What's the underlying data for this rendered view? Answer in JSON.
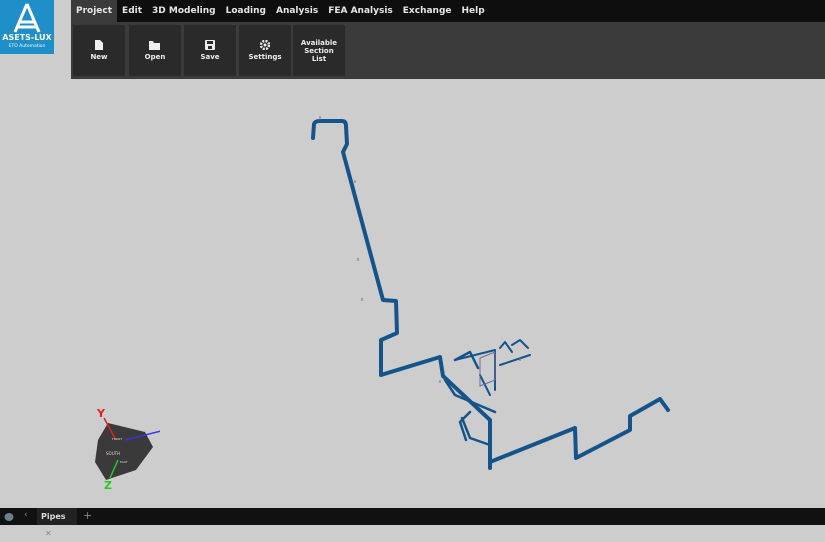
{
  "logo": {
    "brand": "ASETS-LUX",
    "subtitle": "ETO Automation"
  },
  "menu": [
    {
      "label": "Project",
      "active": true
    },
    {
      "label": "Edit"
    },
    {
      "label": "3D Modeling"
    },
    {
      "label": "Loading"
    },
    {
      "label": "Analysis"
    },
    {
      "label": "FEA Analysis"
    },
    {
      "label": "Exchange"
    },
    {
      "label": "Help"
    }
  ],
  "ribbon": [
    {
      "label": "New",
      "icon": "file-icon"
    },
    {
      "label": "Open",
      "icon": "folder-open-icon"
    },
    {
      "label": "Save",
      "icon": "save-icon"
    },
    {
      "label": "Settings",
      "icon": "gear-icon"
    },
    {
      "label": "Available Section List",
      "icon": ""
    }
  ],
  "gizmo": {
    "x": "X",
    "y": "Y",
    "z": "Z",
    "face_top": "FRONT",
    "face_side": "SOUTH",
    "face_label": "EAST"
  },
  "bottom": {
    "tab": "Pipes",
    "close": "✕",
    "add": "+",
    "nav": "‹"
  },
  "colors": {
    "pipe": "#15548a",
    "logo": "#1e8fc8",
    "x_axis": "#3333ee",
    "y_axis": "#dd2222",
    "z_axis": "#22cc22"
  }
}
